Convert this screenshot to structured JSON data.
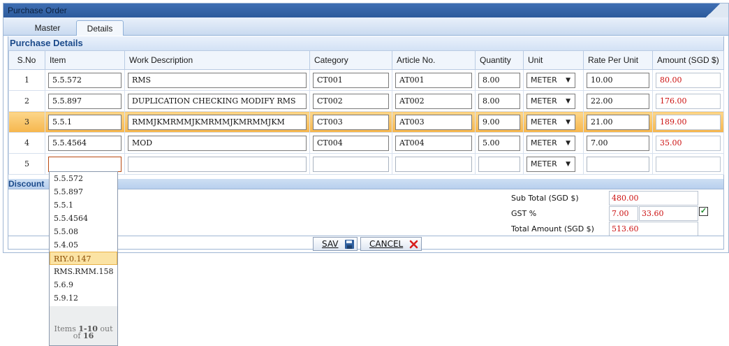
{
  "window": {
    "title": "Purchase Order"
  },
  "tabs": [
    {
      "label": "Master",
      "active": false
    },
    {
      "label": "Details",
      "active": true
    }
  ],
  "section": {
    "title": "Purchase Details"
  },
  "table": {
    "headers": [
      "S.No",
      "Item",
      "Work Description",
      "Category",
      "Article No.",
      "Quantity",
      "Unit",
      "Rate Per Unit",
      "Amount (SGD $)"
    ],
    "rows": [
      {
        "sno": "1",
        "item": "5.5.572",
        "desc": "RMS",
        "category": "CT001",
        "article": "AT001",
        "qty": "8.00",
        "unit": "METER",
        "rate": "10.00",
        "amount": "80.00"
      },
      {
        "sno": "2",
        "item": "5.5.897",
        "desc": "DUPLICATION CHECKING MODIFY RMS",
        "category": "CT002",
        "article": "AT002",
        "qty": "8.00",
        "unit": "METER",
        "rate": "22.00",
        "amount": "176.00"
      },
      {
        "sno": "3",
        "item": "5.5.1",
        "desc": "RMMJKMRMMJKMRMMJKMRMMJKM",
        "category": "CT003",
        "article": "AT003",
        "qty": "9.00",
        "unit": "METER",
        "rate": "21.00",
        "amount": "189.00"
      },
      {
        "sno": "4",
        "item": "5.5.4564",
        "desc": "MOD",
        "category": "CT004",
        "article": "AT004",
        "qty": "5.00",
        "unit": "METER",
        "rate": "7.00",
        "amount": "35.00"
      },
      {
        "sno": "5",
        "item": "",
        "desc": "",
        "category": "",
        "article": "",
        "qty": "",
        "unit": "METER",
        "rate": "",
        "amount": ""
      }
    ],
    "selected_row": 2
  },
  "discount": {
    "label": "Discount"
  },
  "totals": {
    "subtotal_label": "Sub Total (SGD $)",
    "subtotal_value": "480.00",
    "gst_label": "GST %",
    "gst_rate": "7.00",
    "gst_amount": "33.60",
    "gst_checked": true,
    "total_label": "Total Amount (SGD $)",
    "total_value": "513.60"
  },
  "buttons": {
    "save_label": "SAV",
    "cancel_label": "CANCEL"
  },
  "dropdown": {
    "items": [
      "5.5.572",
      "5.5.897",
      "5.5.1",
      "5.5.4564",
      "5.5.08",
      "5.4.05",
      "RIY.0.147",
      "RMS.RMM.158",
      "5.6.9",
      "5.9.12"
    ],
    "highlighted": 6,
    "pager_prefix": "Items",
    "pager_range": "1-10",
    "pager_mid": "out",
    "pager_of": "of",
    "pager_total": "16"
  },
  "colors": {
    "title_bar": "#2c5a9c",
    "selected_row": "#f6b64d",
    "amount_text": "#cc1111",
    "section_text": "#1b4a8a"
  }
}
